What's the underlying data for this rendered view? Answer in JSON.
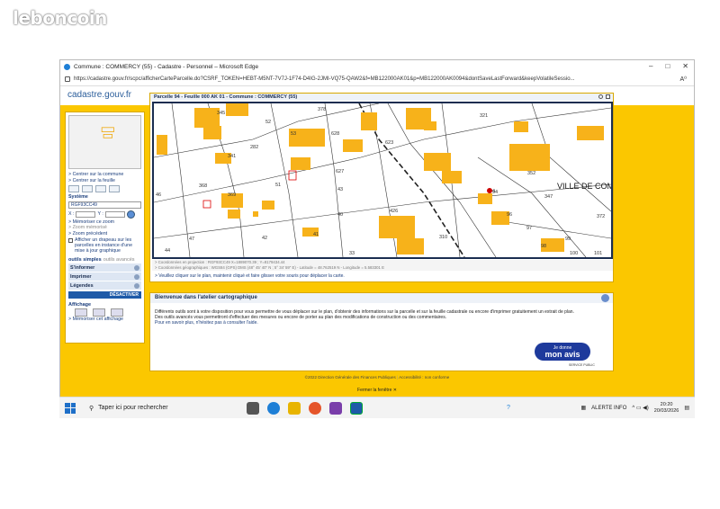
{
  "watermark": "leboncoin",
  "browser": {
    "title": "Commune : COMMERCY (55) - Cadastre - Personnel – Microsoft Edge",
    "url": "https://cadastre.gouv.fr/scpc/afficherCarteParcelle.do?CSRF_TOKEN=HEBT-M5NT-7V7J-1F74-D4IG-2JMI-VQ75-QAW2&f=MB122000AK01&p=MB122000AK0094&dontSaveLastForward&keepVolatileSessio...",
    "controls": {
      "min": "–",
      "max": "□",
      "close": "✕"
    }
  },
  "site": {
    "brand": "cadastre.gouv.fr"
  },
  "left_panel": {
    "links": [
      "> Centrer sur la commune",
      "> Centrer sur la feuille"
    ],
    "system_label": "Système",
    "system_value": "RGF93CC49",
    "x_label": "X :",
    "y_label": "Y :",
    "zoom_links": [
      "> Mémoriser ce zoom",
      "> Zoom mémorisé",
      "> Zoom précédent"
    ],
    "flag_text": "Afficher un drapeau sur les parcelles en instance d'une mise à jour graphique",
    "tab_active": "outils simples",
    "tab_other": "outils avancés",
    "menu": [
      "S'informer",
      "Imprimer",
      "Légendes"
    ],
    "deactivate": "DÉSACTIVER",
    "display_label": "Affichage",
    "memorize_display": "> Mémoriser cet affichage"
  },
  "map_panel": {
    "title": "Parcelle 94 - Feuille 000 AK 01 - Commune : COMMERCY (55)",
    "place_label": "VILLE DE COM",
    "coord_line1": "> Coordonnées en projection :          RGF93CC49          X=1889070.39 ; Y=8179434.44",
    "coord_line2": "> Coordonnées géographiques :          WGS84 (GPS)          DMS (48° 45' 40\" N ; 5° 34' 59\" E) - Latitude = 48.762519 N - Longitude = 5.583301 E",
    "hint": "> Veuillez cliquer sur le plan, maintenir cliqué et faire glisser votre souris pour déplacer la carte.",
    "parcels": [
      "345",
      "52",
      "378",
      "321",
      "282",
      "53",
      "628",
      "623",
      "341",
      "627",
      "352",
      "368",
      "51",
      "347",
      "369",
      "46",
      "43",
      "426",
      "96",
      "97",
      "47",
      "42",
      "41",
      "310",
      "99",
      "98",
      "44",
      "33",
      "100",
      "101",
      "372",
      "4",
      "94",
      "40"
    ]
  },
  "welcome": {
    "title": "Bienvenue dans l'atelier cartographique",
    "text1": "Différents outils sont à votre disposition pour vous permettre de vous déplacer sur le plan, d'obtenir des informations sur la parcelle et sur la feuille cadastrale ou encore d'imprimer gratuitement un extrait de plan.",
    "text2": "Des outils avancés vous permettront d'effectuer des mesures ou encore de porter au plan des modifications de construction ou des commentaires.",
    "text3": "Pour en savoir plus, n'hésitez pas à consulter l'aide.",
    "badge_line1": "Je donne",
    "badge_line2": "mon avis",
    "gov_label": "SERVICE PUBLIC"
  },
  "footer": {
    "copyright": "©2022 Direction Générale des Finances Publiques",
    "sep": "|",
    "access": "Accessibilité : non conforme",
    "close_window": "Fermer la fenêtre"
  },
  "taskbar": {
    "search_placeholder": "Taper ici pour rechercher",
    "alert": "ALERTE INFO",
    "time": "20:20",
    "date": "20/03/2026"
  },
  "colors": {
    "yellow": "#fbc700",
    "building": "#f7b21a",
    "navy": "#1a2d50"
  }
}
